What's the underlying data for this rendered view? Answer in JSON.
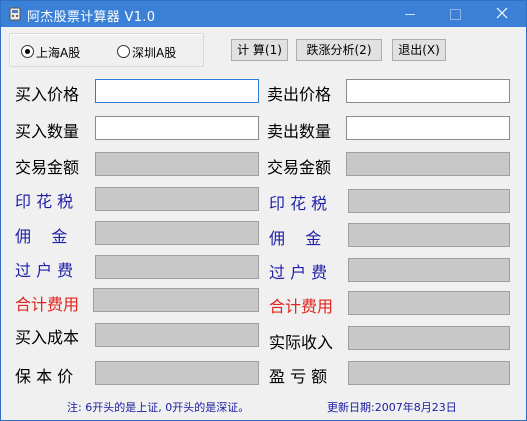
{
  "window": {
    "title": "阿杰股票计算器 V1.0"
  },
  "market": {
    "options": [
      {
        "label": "上海A股",
        "selected": true
      },
      {
        "label": "深圳A股",
        "selected": false
      }
    ]
  },
  "buttons": {
    "calculate": "计 算(1)",
    "analysis": "跌涨分析(2)",
    "exit": "退出(X)"
  },
  "fields": {
    "buy_price": {
      "label": "买入价格",
      "value": ""
    },
    "buy_quantity": {
      "label": "买入数量",
      "value": ""
    },
    "buy_amount": {
      "label": "交易金额",
      "value": ""
    },
    "buy_stamp_tax": {
      "label": "印 花 税",
      "value": ""
    },
    "buy_commission": {
      "label": "佣    金",
      "value": ""
    },
    "buy_transfer_fee": {
      "label": "过 户 费",
      "value": ""
    },
    "buy_total_fees": {
      "label": "合计费用",
      "value": ""
    },
    "buy_cost": {
      "label": "买入成本",
      "value": ""
    },
    "break_even_price": {
      "label": "保 本 价",
      "value": ""
    },
    "sell_price": {
      "label": "卖出价格",
      "value": ""
    },
    "sell_quantity": {
      "label": "卖出数量",
      "value": ""
    },
    "sell_amount": {
      "label": "交易金额",
      "value": ""
    },
    "sell_stamp_tax": {
      "label": "印 花 税",
      "value": ""
    },
    "sell_commission": {
      "label": "佣    金",
      "value": ""
    },
    "sell_transfer_fee": {
      "label": "过 户 费",
      "value": ""
    },
    "sell_total_fees": {
      "label": "合计费用",
      "value": ""
    },
    "actual_income": {
      "label": "实际收入",
      "value": ""
    },
    "profit_loss": {
      "label": "盈 亏 额",
      "value": ""
    }
  },
  "status": {
    "note": "注: 6开头的是上证, 0开头的是深证。",
    "update_date": "更新日期:2007年8月23日"
  },
  "colors": {
    "titlebar": "#3a80d6",
    "fee_label_blue": "#1f1fa8",
    "total_label_red": "#e0261f",
    "readonly_field": "#c8c8c8"
  }
}
